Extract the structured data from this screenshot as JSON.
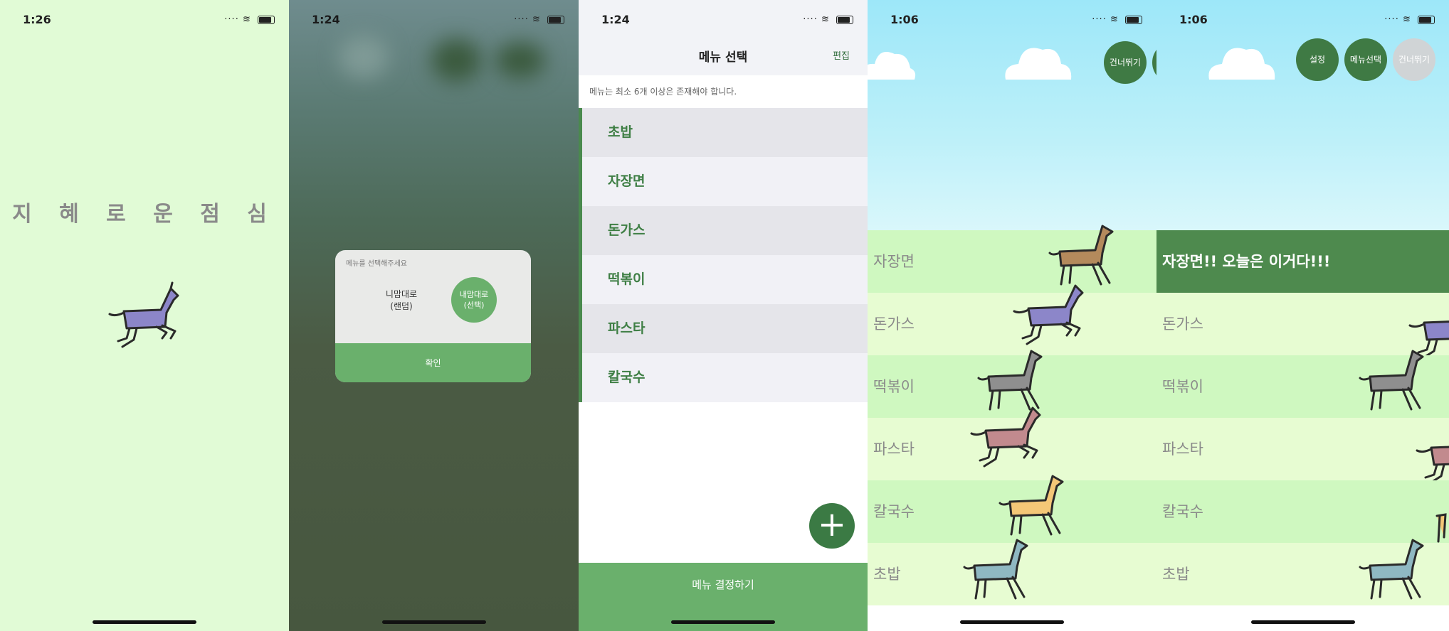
{
  "colors": {
    "green": "#6ab06c",
    "dark_green": "#3f7a44",
    "text_green": "#3f7f45",
    "splash_bg": "#e1fbd6"
  },
  "screen1": {
    "time": "1:26",
    "title": "지 혜 로 운 점 심"
  },
  "screen2": {
    "time": "1:24",
    "dialog": {
      "title": "메뉴를 선택해주세요",
      "option_random_line1": "니맘대로",
      "option_random_line2": "(랜덤)",
      "option_select_line1": "내맘대로",
      "option_select_line2": "(선택)",
      "confirm": "확인"
    }
  },
  "screen3": {
    "time": "1:24",
    "nav_title": "메뉴 선택",
    "edit": "편집",
    "notice": "메뉴는 최소 6개 이상은 존재해야 합니다.",
    "menu_items": [
      "초밥",
      "자장면",
      "돈가스",
      "떡볶이",
      "파스타",
      "칼국수"
    ],
    "add_icon": "plus-icon",
    "decide_button": "메뉴 결정하기"
  },
  "screen4": {
    "time": "1:06",
    "skip_button": "건너뛰기",
    "lanes": [
      "자장면",
      "돈가스",
      "떡볶이",
      "파스타",
      "칼국수",
      "초밥"
    ]
  },
  "screen5": {
    "time": "1:06",
    "settings_button": "설정",
    "menu_select_button": "메뉴선택",
    "skip_button": "건너뛰기",
    "winner_text": "자장면!! 오늘은 이거다!!!",
    "lanes": [
      "돈가스",
      "떡볶이",
      "파스타",
      "칼국수",
      "초밥"
    ]
  }
}
